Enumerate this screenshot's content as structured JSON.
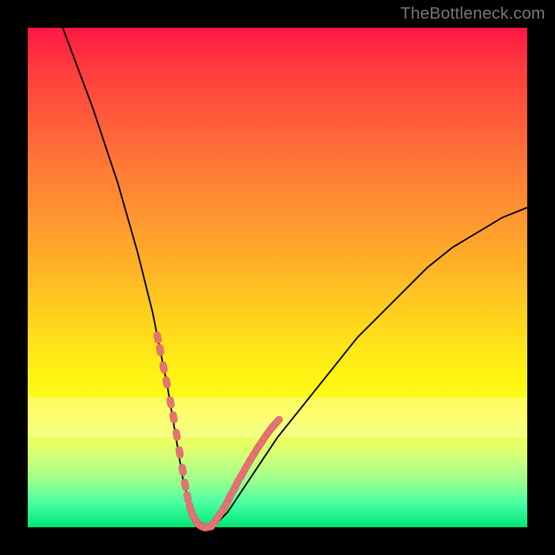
{
  "watermark": "TheBottleneck.com",
  "colors": {
    "frame": "#000000",
    "curve": "#000000",
    "marker_fill": "#e57373",
    "marker_stroke": "#d65a5a"
  },
  "chart_data": {
    "type": "line",
    "title": "",
    "xlabel": "",
    "ylabel": "",
    "xlim": [
      0,
      100
    ],
    "ylim": [
      0,
      100
    ],
    "grid": false,
    "legend": false,
    "series": [
      {
        "name": "bottleneck-curve",
        "x": [
          7,
          10,
          13,
          16,
          18,
          20,
          22,
          24,
          25,
          26,
          27,
          28,
          29,
          30,
          31,
          32,
          33,
          34,
          35,
          36,
          38,
          40,
          42,
          44,
          46,
          48,
          50,
          54,
          58,
          62,
          66,
          70,
          75,
          80,
          85,
          90,
          95,
          100
        ],
        "y": [
          100,
          92,
          84,
          75,
          69,
          62,
          55,
          47,
          43,
          38,
          33,
          28,
          22,
          16,
          10,
          6,
          3,
          1,
          0,
          0,
          1,
          3,
          6,
          9,
          12,
          15,
          18,
          23,
          28,
          33,
          38,
          42,
          47,
          52,
          56,
          59,
          62,
          64
        ]
      }
    ],
    "markers": {
      "name": "highlighted-points",
      "x_left": [
        26.0,
        26.5,
        27.2,
        27.8,
        28.6,
        29.2,
        29.8,
        30.4,
        31.0,
        31.5,
        32.0,
        32.5,
        33.0,
        33.5,
        34.0,
        34.5,
        35.0,
        35.5,
        36.0,
        36.5
      ],
      "y_left": [
        38,
        35.5,
        32,
        29,
        25,
        22,
        18.5,
        15,
        11.5,
        8.5,
        6,
        4,
        2.5,
        1.5,
        0.8,
        0.4,
        0.1,
        0,
        0,
        0.2
      ],
      "x_right": [
        37.0,
        37.5,
        38.2,
        39.0,
        39.8,
        40.5,
        41.3,
        42.0,
        42.8,
        43.6,
        44.4,
        45.2,
        46.0,
        46.8,
        47.6,
        48.4,
        49.2,
        50.0
      ],
      "y_right": [
        0.5,
        1.2,
        2.2,
        3.4,
        4.8,
        6.2,
        7.6,
        9.0,
        10.4,
        11.8,
        13.2,
        14.5,
        15.8,
        17.0,
        18.2,
        19.3,
        20.3,
        21.2
      ]
    },
    "pale_band_y": [
      18,
      26
    ]
  }
}
